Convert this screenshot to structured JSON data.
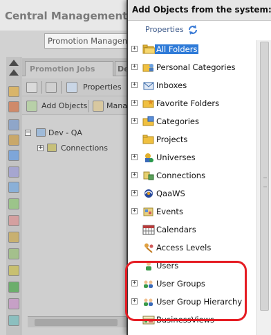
{
  "background": {
    "app_title": "Central Management C",
    "combo_value": "Promotion Managem",
    "tabs": [
      "Promotion Jobs",
      "De"
    ],
    "toolbar": {
      "properties": "Properties",
      "add_objects": "Add Objects",
      "manage": "Mana"
    },
    "tree": {
      "root": "Dev - QA",
      "child": "Connections"
    }
  },
  "dialog": {
    "title": "Add Objects from the system: a",
    "toolbar": {
      "properties": "Properties"
    },
    "tree": [
      {
        "label": "All Folders",
        "icon": "open-folder-icon",
        "expandable": true,
        "selected": true
      },
      {
        "label": "Personal Categories",
        "icon": "personal-categories-icon",
        "expandable": true
      },
      {
        "label": "Inboxes",
        "icon": "inbox-icon",
        "expandable": true
      },
      {
        "label": "Favorite Folders",
        "icon": "favorites-folder-icon",
        "expandable": true
      },
      {
        "label": "Categories",
        "icon": "categories-icon",
        "expandable": true
      },
      {
        "label": "Projects",
        "icon": "folder-icon",
        "expandable": false
      },
      {
        "label": "Universes",
        "icon": "universe-icon",
        "expandable": true
      },
      {
        "label": "Connections",
        "icon": "connection-icon",
        "expandable": true
      },
      {
        "label": "QaaWS",
        "icon": "qaaws-icon",
        "expandable": true
      },
      {
        "label": "Events",
        "icon": "events-icon",
        "expandable": true
      },
      {
        "label": "Calendars",
        "icon": "calendar-icon",
        "expandable": false
      },
      {
        "label": "Access Levels",
        "icon": "access-levels-icon",
        "expandable": false
      },
      {
        "label": "Users",
        "icon": "user-icon",
        "expandable": false
      },
      {
        "label": "User Groups",
        "icon": "user-groups-icon",
        "expandable": true
      },
      {
        "label": "User Group Hierarchy",
        "icon": "user-group-hierarchy-icon",
        "expandable": true
      },
      {
        "label": "BusinessViews",
        "icon": "business-views-icon",
        "expandable": false
      }
    ]
  },
  "colors": {
    "selection": "#2f7bd8",
    "annotation": "#e51c23"
  }
}
